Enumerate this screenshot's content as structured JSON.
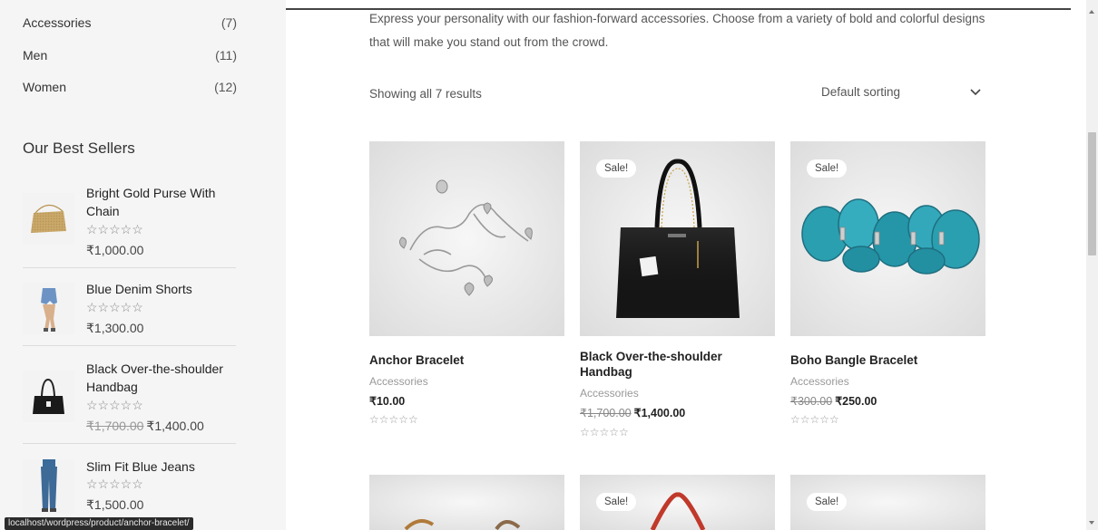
{
  "sidebar": {
    "categories": [
      {
        "label": "Accessories",
        "count": "(7)"
      },
      {
        "label": "Men",
        "count": "(11)"
      },
      {
        "label": "Women",
        "count": "(12)"
      }
    ],
    "best_sellers_title": "Our Best Sellers",
    "best_sellers": [
      {
        "name": "Bright Gold Purse With Chain",
        "stars": "☆☆☆☆☆",
        "price": "₹1,000.00",
        "old_price": ""
      },
      {
        "name": "Blue Denim Shorts",
        "stars": "☆☆☆☆☆",
        "price": "₹1,300.00",
        "old_price": ""
      },
      {
        "name": "Black Over-the-shoulder Handbag",
        "stars": "☆☆☆☆☆",
        "price": "₹1,400.00",
        "old_price": "₹1,700.00"
      },
      {
        "name": "Slim Fit Blue Jeans",
        "stars": "☆☆☆☆☆",
        "price": "₹1,500.00",
        "old_price": ""
      }
    ]
  },
  "status_url": "localhost/wordpress/product/anchor-bracelet/",
  "main": {
    "intro": "Express your personality with our fashion-forward accessories. Choose from a variety of bold and colorful designs that will make you stand out from the crowd.",
    "result_count": "Showing all 7 results",
    "sort_label": "Default sorting",
    "products": [
      {
        "name": "Anchor Bracelet",
        "category": "Accessories",
        "price": "₹10.00",
        "old_price": "",
        "sale": "",
        "stars": "☆☆☆☆☆"
      },
      {
        "name": "Black Over-the-shoulder Handbag",
        "category": "Accessories",
        "price": "₹1,400.00",
        "old_price": "₹1,700.00",
        "sale": "Sale!",
        "stars": "☆☆☆☆☆"
      },
      {
        "name": "Boho Bangle Bracelet",
        "category": "Accessories",
        "price": "₹250.00",
        "old_price": "₹300.00",
        "sale": "Sale!",
        "stars": "☆☆☆☆☆"
      },
      {
        "name": "",
        "category": "",
        "price": "",
        "old_price": "",
        "sale": "",
        "stars": ""
      },
      {
        "name": "",
        "category": "",
        "price": "",
        "old_price": "",
        "sale": "Sale!",
        "stars": ""
      },
      {
        "name": "",
        "category": "",
        "price": "",
        "old_price": "",
        "sale": "Sale!",
        "stars": ""
      }
    ]
  },
  "colors": {
    "sidebar_bg": "#f5f5f6",
    "card_bg": "#e4e4e4",
    "turquoise": "#2a9fb0",
    "handbag_black": "#1a1a1a",
    "handbag_red": "#c0392b"
  }
}
